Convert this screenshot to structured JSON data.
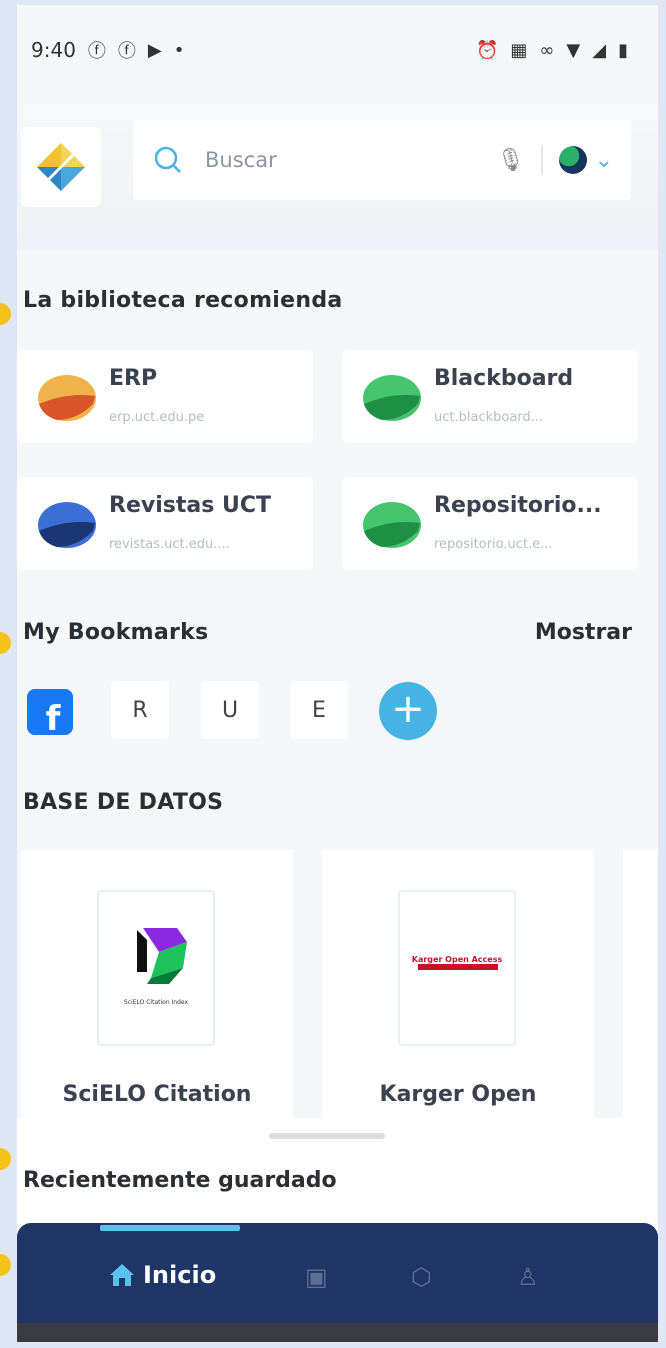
{
  "status_bar": {
    "time": "9:40",
    "left_icons": [
      "facebook-icon",
      "facebook-icon",
      "youtube-icon",
      "dot-icon"
    ],
    "right_icons": [
      "alarm-icon",
      "calendar-icon",
      "link-icon",
      "wifi-icon",
      "signal-icon",
      "battery-icon"
    ]
  },
  "header": {
    "search": {
      "placeholder": "Buscar"
    },
    "accent_color": "#45b4e4"
  },
  "recommend": {
    "title": "La biblioteca recomienda",
    "cards": [
      {
        "title": "ERP",
        "url": "erp.uct.edu.pe",
        "color": "#e88a3a"
      },
      {
        "title": "Blackboard",
        "url": "uct.blackboard...",
        "color": "#2cb15c"
      },
      {
        "title": "Revistas UCT",
        "url": "revistas.uct.edu....",
        "color": "#2e58b8"
      },
      {
        "title": "Repositorio...",
        "url": "repositorio.uct.e...",
        "color": "#2cb15c"
      }
    ]
  },
  "bookmarks": {
    "title": "My Bookmarks",
    "show_label": "Mostrar",
    "items": [
      "R",
      "U",
      "E"
    ],
    "add_label": "+"
  },
  "databases": {
    "title": "BASE DE DATOS",
    "items": [
      {
        "name": "SciELO Citation",
        "thumb_caption": "SciELO Citation Index"
      },
      {
        "name": "Karger Open",
        "thumb_caption": "Karger Open Access"
      }
    ]
  },
  "recent": {
    "title": "Recientemente guardado"
  },
  "bottom_nav": {
    "home_label": "Inicio",
    "active_color": "#5bc0ea",
    "bg_color": "#1f3566"
  }
}
